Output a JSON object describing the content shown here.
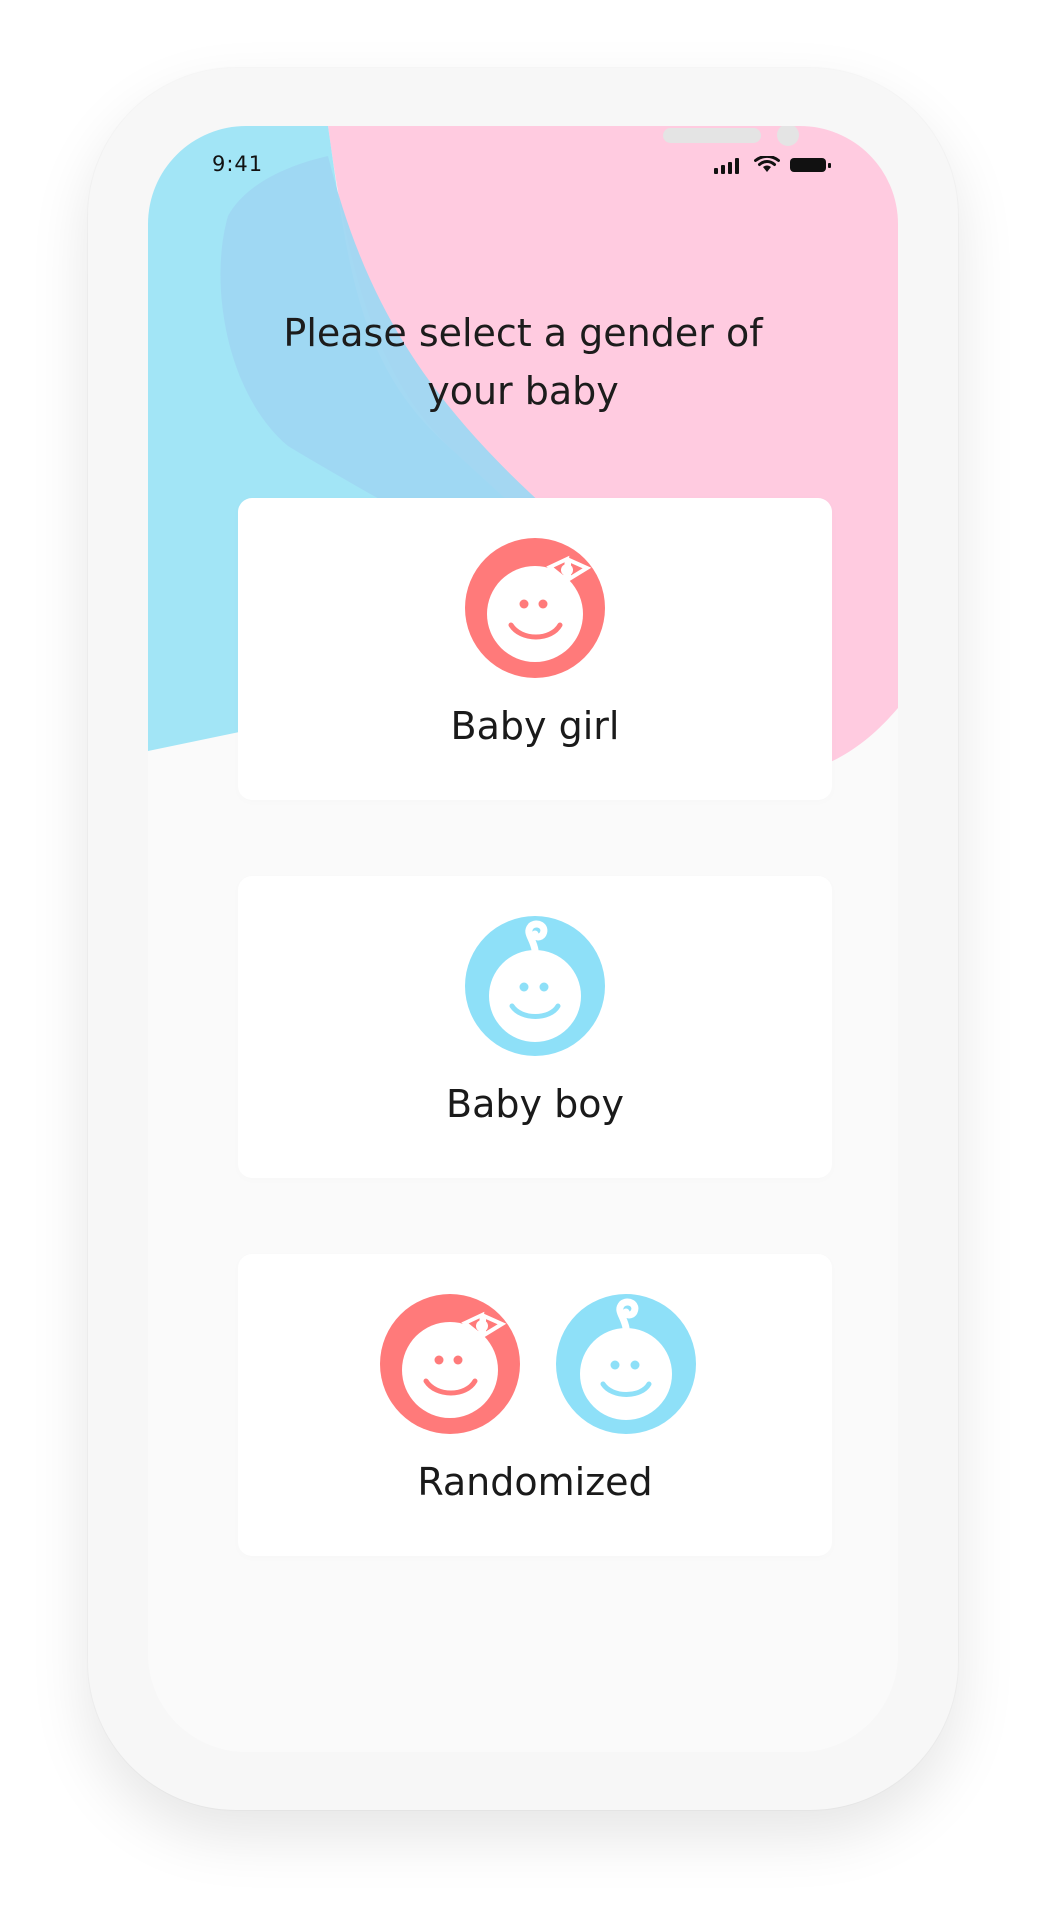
{
  "status_bar": {
    "time": "9:41"
  },
  "screen": {
    "title": "Please select a gender of your baby"
  },
  "options": [
    {
      "label": "Baby girl",
      "icon": "baby-girl-face-icon"
    },
    {
      "label": "Baby boy",
      "icon": "baby-boy-face-icon"
    },
    {
      "label": "Randomized",
      "icon": "baby-girl-and-boy-faces-icon"
    }
  ],
  "colors": {
    "pink_background": "#ffcbe0",
    "blue_background": "#a2e5f6",
    "girl_accent": "#ff7a7a",
    "boy_accent": "#8ee0f8"
  }
}
